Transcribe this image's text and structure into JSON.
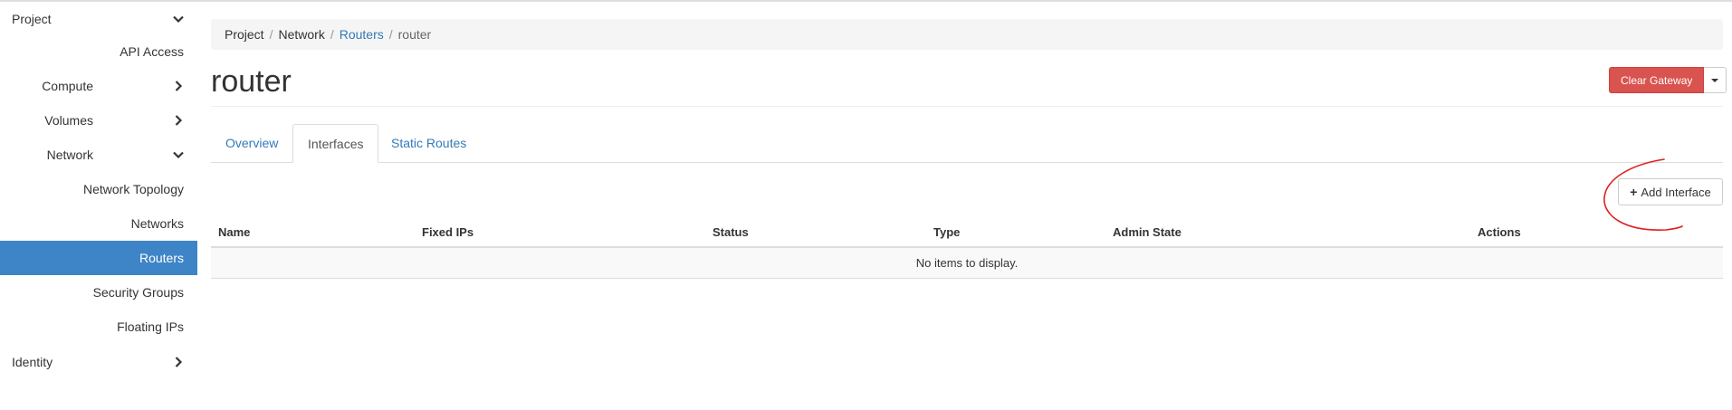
{
  "sidebar": {
    "project": "Project",
    "api_access": "API Access",
    "compute": "Compute",
    "volumes": "Volumes",
    "network": "Network",
    "network_topology": "Network Topology",
    "networks": "Networks",
    "routers": "Routers",
    "security_groups": "Security Groups",
    "floating_ips": "Floating IPs",
    "identity": "Identity"
  },
  "breadcrumb": {
    "items": [
      "Project",
      "Network",
      "Routers",
      "router"
    ],
    "separator": "/"
  },
  "page": {
    "title": "router",
    "clear_gateway": "Clear Gateway"
  },
  "tabs": [
    "Overview",
    "Interfaces",
    "Static Routes"
  ],
  "toolbar": {
    "add_interface": "Add Interface"
  },
  "table": {
    "columns": [
      "Name",
      "Fixed IPs",
      "Status",
      "Type",
      "Admin State",
      "Actions"
    ],
    "empty_message": "No items to display."
  },
  "colors": {
    "active_nav": "#3d85c6",
    "link": "#337ab7",
    "danger": "#d9534f",
    "annotation": "#e02020"
  }
}
